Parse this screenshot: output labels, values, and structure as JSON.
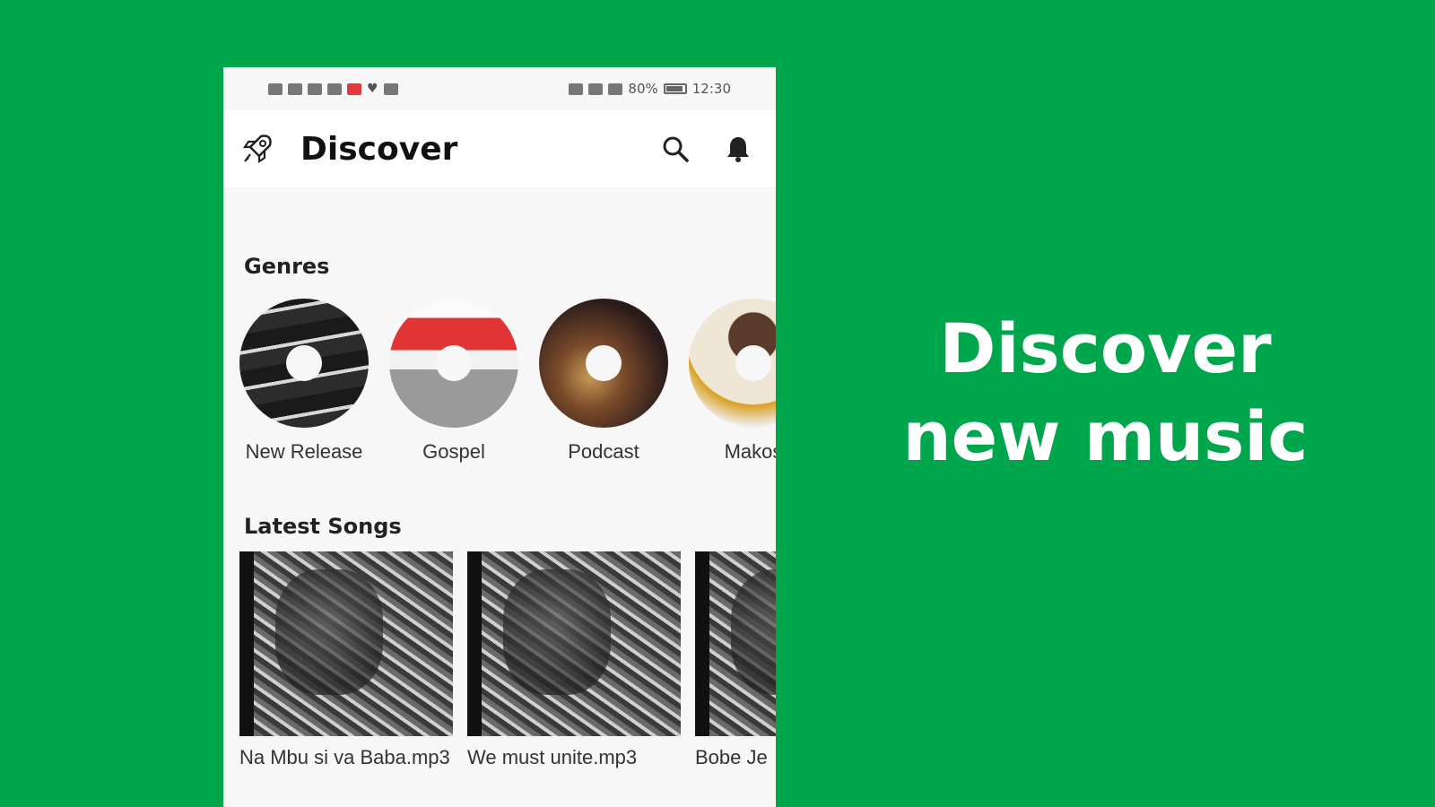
{
  "status_bar": {
    "battery_percent": "80%",
    "time": "12:30"
  },
  "app_bar": {
    "title": "Discover",
    "logo_icon": "rocket-icon",
    "actions": [
      "search-icon",
      "bell-icon"
    ]
  },
  "genres": {
    "title": "Genres",
    "items": [
      {
        "label": "New Release"
      },
      {
        "label": "Gospel"
      },
      {
        "label": "Podcast"
      },
      {
        "label": "Makos"
      }
    ]
  },
  "latest_songs": {
    "title": "Latest Songs",
    "items": [
      {
        "label": "Na Mbu si va Baba.mp3"
      },
      {
        "label": "We must unite.mp3"
      },
      {
        "label": "Bobe Je"
      }
    ]
  },
  "promo": {
    "line1": "Discover",
    "line2": "new music"
  },
  "colors": {
    "background": "#00a64b",
    "app_bg": "#f7f7f7"
  }
}
